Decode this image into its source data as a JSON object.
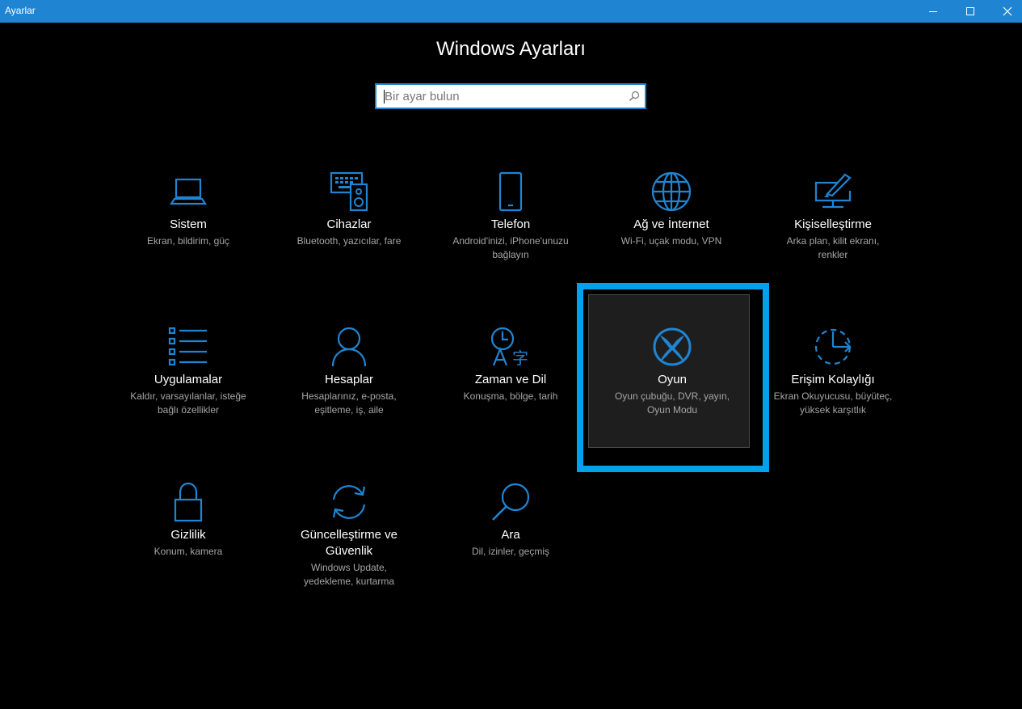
{
  "window": {
    "title": "Ayarlar",
    "controls": [
      "minimize-icon",
      "maximize-icon",
      "close-icon"
    ]
  },
  "page": {
    "title": "Windows Ayarları"
  },
  "search": {
    "placeholder": "Bir ayar bulun",
    "value": "",
    "icon": "search-icon"
  },
  "accent_color": "#1f85d3",
  "selection_color": "#00a2ed",
  "categories": [
    {
      "name": "Sistem",
      "desc": [
        "Ekran, bildirim, güç"
      ],
      "icon": "laptop-icon"
    },
    {
      "name": "Cihazlar",
      "desc": [
        "Bluetooth, yazıcılar, fare"
      ],
      "icon": "devices-icon"
    },
    {
      "name": "Telefon",
      "desc": [
        "Android'inizi, iPhone'unuzu",
        "bağlayın"
      ],
      "icon": "phone-icon"
    },
    {
      "name": "Ağ ve İnternet",
      "desc": [
        "Wi-Fi, uçak modu, VPN"
      ],
      "icon": "globe-icon"
    },
    {
      "name": "Kişiselleştirme",
      "desc": [
        "Arka plan, kilit ekranı,",
        "renkler"
      ],
      "icon": "paint-icon"
    },
    {
      "name": "Uygulamalar",
      "desc": [
        "Kaldır, varsayılanlar, isteğe",
        "bağlı özellikler"
      ],
      "icon": "apps-list-icon"
    },
    {
      "name": "Hesaplar",
      "desc": [
        "Hesaplarınız, e-posta,",
        "eşitleme, iş, aile"
      ],
      "icon": "person-icon"
    },
    {
      "name": "Zaman ve Dil",
      "desc": [
        "Konuşma, bölge, tarih"
      ],
      "icon": "time-language-icon"
    },
    {
      "name": "Oyun",
      "desc": [
        "Oyun çubuğu, DVR, yayın,",
        "Oyun Modu"
      ],
      "icon": "xbox-icon",
      "selected": true
    },
    {
      "name": "Erişim Kolaylığı",
      "desc": [
        "Ekran Okuyucusu, büyüteç,",
        "yüksek karşıtlık"
      ],
      "icon": "ease-of-access-icon"
    },
    {
      "name": "Gizlilik",
      "desc": [
        "Konum, kamera"
      ],
      "icon": "lock-icon"
    },
    {
      "name": "Güncelleştirme ve Güvenlik",
      "name_lines": [
        "Güncelleştirme ve",
        "Güvenlik"
      ],
      "desc": [
        "Windows Update,",
        "yedekleme, kurtarma"
      ],
      "icon": "sync-icon"
    },
    {
      "name": "Ara",
      "desc": [
        "Dil, izinler, geçmiş"
      ],
      "icon": "search-magnifier-icon"
    }
  ]
}
